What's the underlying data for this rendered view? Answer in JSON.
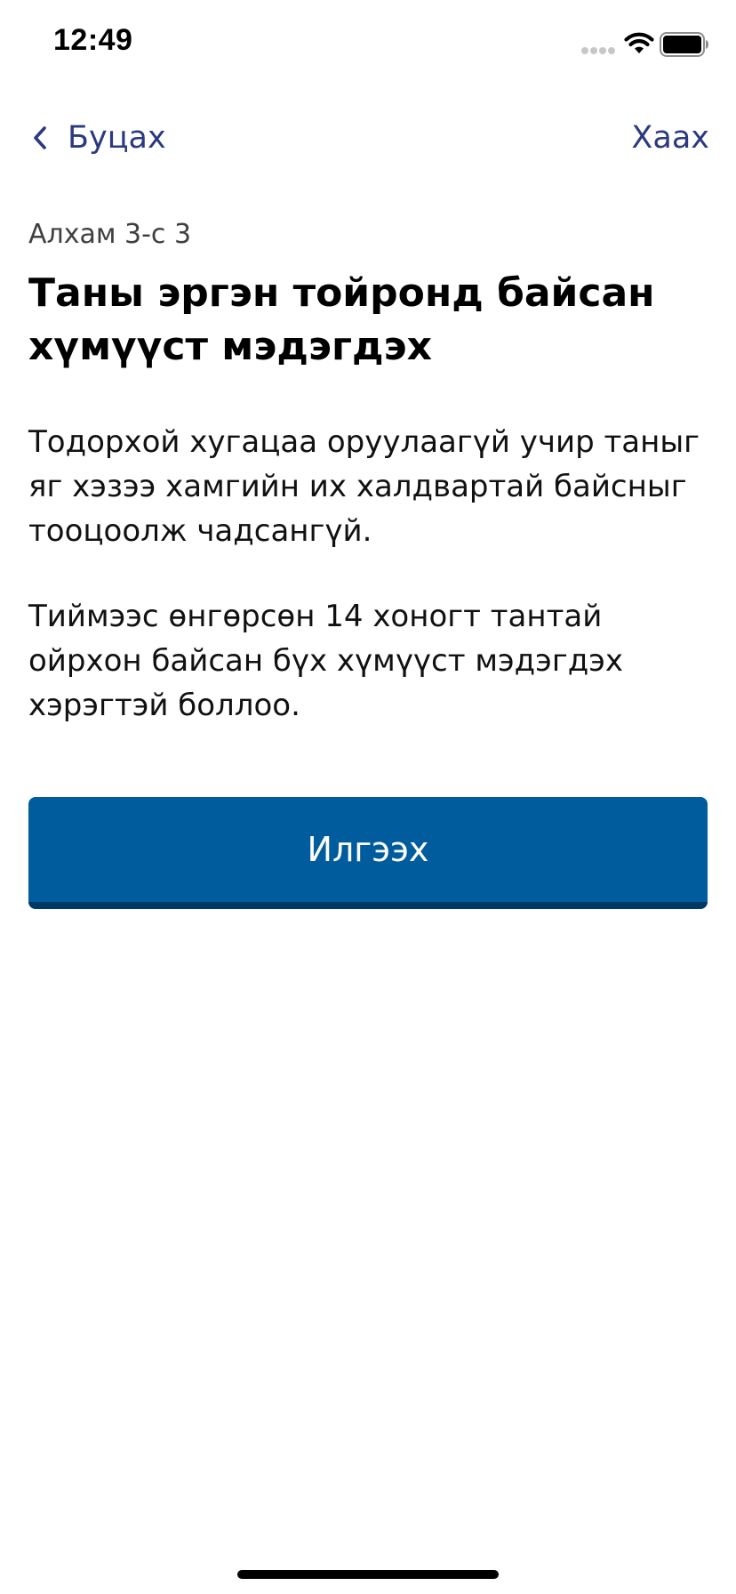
{
  "status_bar": {
    "time": "12:49",
    "icons": [
      "signal-icon",
      "wifi-icon",
      "battery-icon"
    ]
  },
  "nav": {
    "back_label": "Буцах",
    "back_icon": "chevron-left-icon",
    "close_label": "Хаах"
  },
  "content": {
    "step_label": "Алхам 3-с 3",
    "title": "Таны эргэн тойронд байсан хүмүүст мэдэгдэх",
    "paragraph_1": "Тодорхой хугацаа оруулаагүй учир таныг яг хэзээ хамгийн их халдвартай байсныг тооцоолж чадсангүй.",
    "paragraph_2": "Тиймээс өнгөрсөн 14 хоногт тантай ойрхон байсан бүх хүмүүст мэдэгдэх хэрэгтэй боллоо.",
    "send_button_label": "Илгээх"
  },
  "colors": {
    "accent": "#2b3a7f",
    "button_bg": "#005c9d",
    "button_shadow": "#003968",
    "background": "#ffffff"
  }
}
